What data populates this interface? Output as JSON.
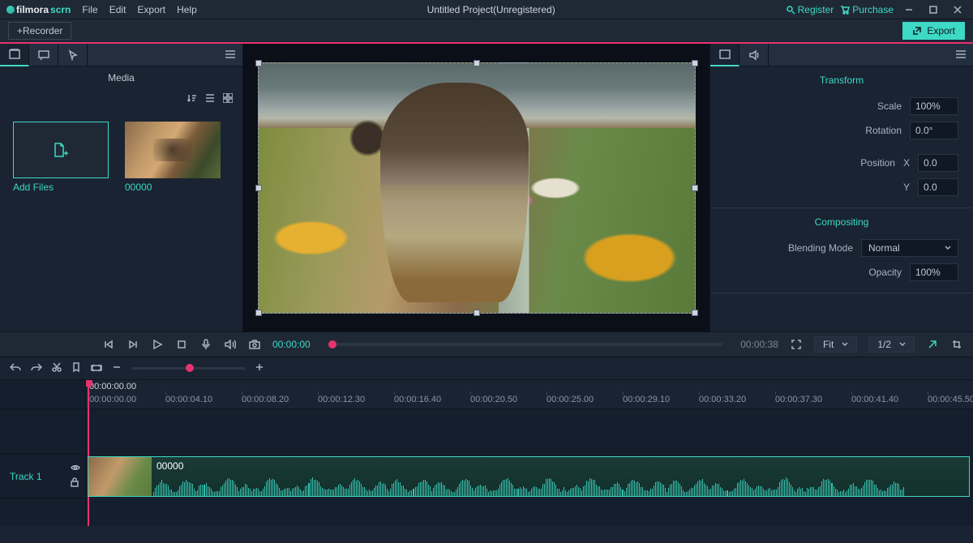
{
  "brand": {
    "name": "filmora",
    "accent": "scrn"
  },
  "menu": [
    "File",
    "Edit",
    "Export",
    "Help"
  ],
  "window_title": "Untitled Project(Unregistered)",
  "top_links": {
    "register": "Register",
    "purchase": "Purchase"
  },
  "recorder_btn": "+Recorder",
  "export_btn": "Export",
  "media": {
    "title": "Media",
    "tiles": [
      {
        "label": "Add Files"
      },
      {
        "label": "00000"
      }
    ]
  },
  "playback": {
    "current": "00:00:00",
    "duration": "00:00:38",
    "fit": "Fit",
    "scale": "1/2"
  },
  "props": {
    "transform_title": "Transform",
    "scale_label": "Scale",
    "scale_value": "100%",
    "rotation_label": "Rotation",
    "rotation_value": "0.0°",
    "position_label": "Position",
    "pos_x_label": "X",
    "pos_x": "0.0",
    "pos_y_label": "Y",
    "pos_y": "0.0",
    "compositing_title": "Compositing",
    "blend_label": "Blending Mode",
    "blend_value": "Normal",
    "opacity_label": "Opacity",
    "opacity_value": "100%"
  },
  "timeline": {
    "playhead": "00:00:00.00",
    "ticks": [
      "00:00:00.00",
      "00:00:04.10",
      "00:00:08.20",
      "00:00:12.30",
      "00:00:16.40",
      "00:00:20.50",
      "00:00:25.00",
      "00:00:29.10",
      "00:00:33.20",
      "00:00:37.30",
      "00:00:41.40",
      "00:00:45.50"
    ],
    "track_label": "Track 1",
    "clip_name": "00000"
  }
}
